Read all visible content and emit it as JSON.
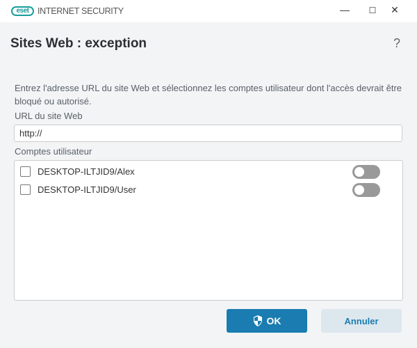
{
  "titlebar": {
    "logo": "eset",
    "product": "INTERNET SECURITY",
    "minimize": "—",
    "maximize": "☐",
    "close": "✕"
  },
  "dialog": {
    "title": "Sites Web : exception",
    "help": "?",
    "description": "Entrez l'adresse URL du site Web et sélectionnez les comptes utilisateur dont l'accès devrait être bloqué ou autorisé.",
    "url_label": "URL du site Web",
    "url_value": "http://",
    "accounts_label": "Comptes utilisateur",
    "accounts": [
      {
        "name": "DESKTOP-ILTJID9/Alex",
        "checked": false,
        "allowed": false
      },
      {
        "name": "DESKTOP-ILTJID9/User",
        "checked": false,
        "allowed": false
      }
    ],
    "ok": "OK",
    "cancel": "Annuler"
  },
  "colors": {
    "accent": "#1a7cb0",
    "brand": "#1a9c9c"
  }
}
